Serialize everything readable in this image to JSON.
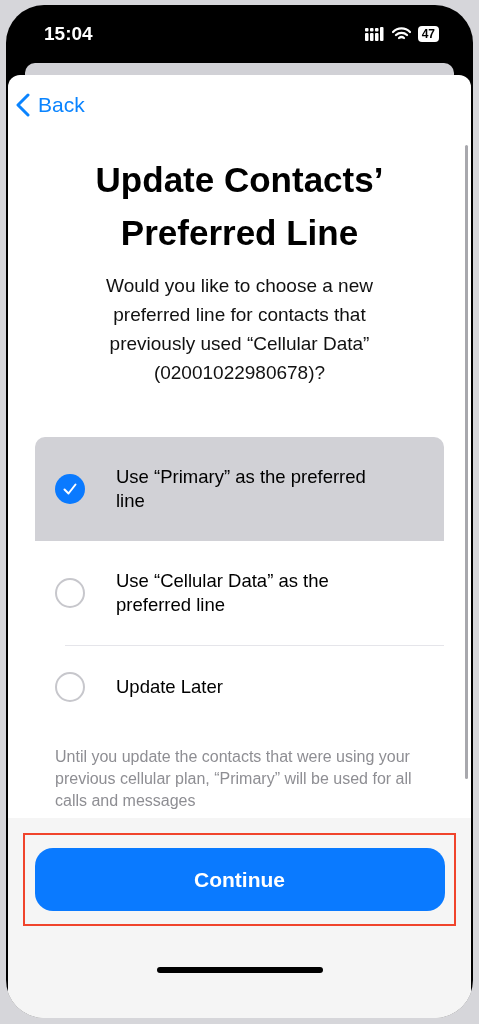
{
  "status_bar": {
    "time": "15:04",
    "battery": "47"
  },
  "nav": {
    "back": "Back"
  },
  "title": "Update Contacts’ Preferred Line",
  "message": "Would you like to choose a new preferred line for contacts that previously used “Cellular Data” (02001022980678)?",
  "options": [
    {
      "label": "Use “Primary” as the preferred line",
      "selected": true
    },
    {
      "label": "Use “Cellular Data” as the preferred line",
      "selected": false
    },
    {
      "label": "Update Later",
      "selected": false
    }
  ],
  "footnote": "Until you update the contacts that were using your previous cellular plan, “Primary” will be used for all calls and messages",
  "button": "Continue"
}
